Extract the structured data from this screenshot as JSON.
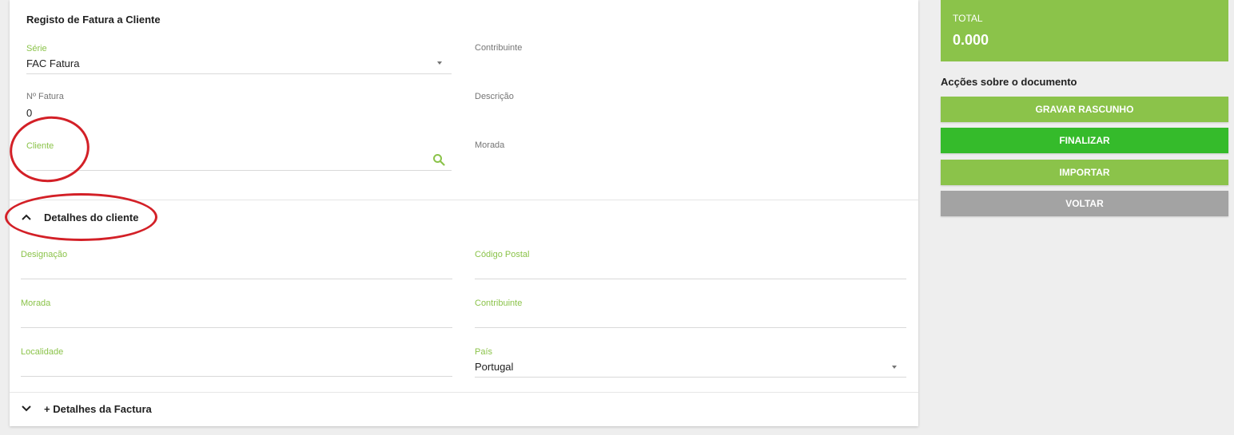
{
  "form": {
    "title": "Registo de Fatura a Cliente",
    "serie": {
      "label": "Série",
      "value": "FAC Fatura"
    },
    "contribuinte": {
      "label": "Contribuinte",
      "value": ""
    },
    "num_fatura": {
      "label": "Nº Fatura",
      "value": "0"
    },
    "descricao": {
      "label": "Descrição",
      "value": ""
    },
    "cliente": {
      "label": "Cliente",
      "value": ""
    },
    "morada": {
      "label": "Morada",
      "value": ""
    }
  },
  "client_details": {
    "header": "Detalhes do cliente",
    "designacao": {
      "label": "Designação",
      "value": ""
    },
    "codigo_postal": {
      "label": "Código Postal",
      "value": ""
    },
    "morada": {
      "label": "Morada",
      "value": ""
    },
    "contribuinte": {
      "label": "Contribuinte",
      "value": ""
    },
    "localidade": {
      "label": "Localidade",
      "value": ""
    },
    "pais": {
      "label": "País",
      "value": "Portugal"
    }
  },
  "invoice_details": {
    "header": "+ Detalhes da Factura"
  },
  "sidebar": {
    "total_label": "TOTAL",
    "total_value": "0.000",
    "actions_title": "Acções sobre o documento",
    "buttons": {
      "save_draft": "GRAVAR RASCUNHO",
      "finalize": "FINALIZAR",
      "import": "IMPORTAR",
      "back": "VOLTAR"
    }
  },
  "colors": {
    "accent_green": "#8bc34a",
    "finalize_green": "#35bb2b",
    "back_gray": "#a3a3a3",
    "annotation_red": "#d32027"
  },
  "icons": [
    "search-icon",
    "chevron-up-icon",
    "chevron-down-icon",
    "dropdown-caret-icon"
  ]
}
